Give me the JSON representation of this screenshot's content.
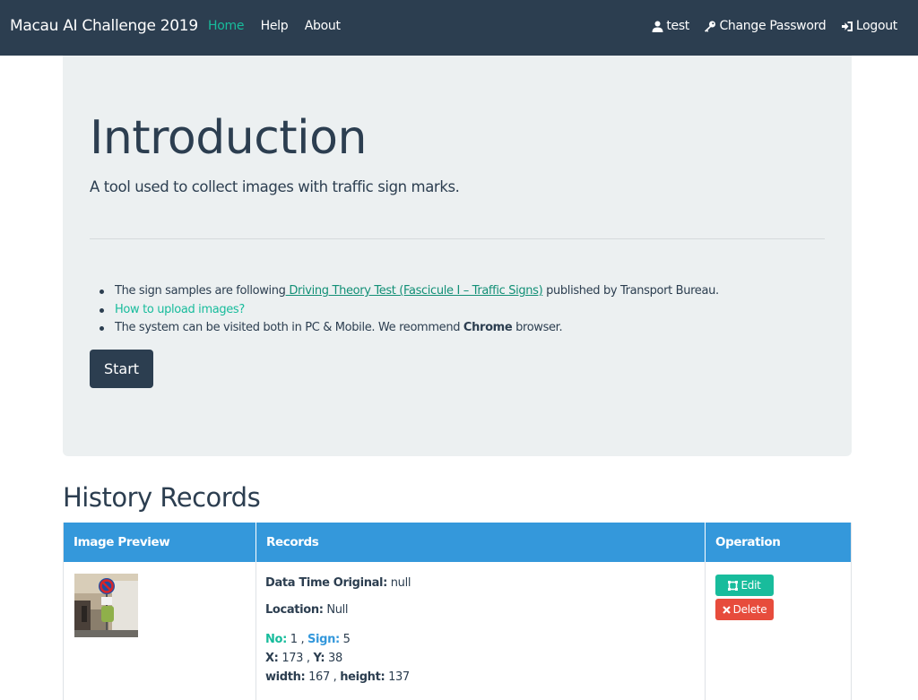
{
  "navbar": {
    "brand": "Macau AI Challenge 2019",
    "links": [
      "Home",
      "Help",
      "About"
    ],
    "active": "Home",
    "user": "test",
    "change_password": "Change Password",
    "logout": "Logout"
  },
  "intro": {
    "title": "Introduction",
    "lead": "A tool used to collect images with traffic sign marks.",
    "bullet1_pre": "The sign samples are following",
    "bullet1_link": " Driving Theory Test (Fascicule I – Traffic Signs)",
    "bullet1_post": " published by Transport Bureau.",
    "bullet2_link": "How to upload images?",
    "bullet3_pre": "The system can be visited both in PC & Mobile. We reommend ",
    "bullet3_bold": "Chrome",
    "bullet3_post": " browser.",
    "start_label": "Start"
  },
  "history": {
    "title": "History Records",
    "columns": [
      "Image Preview",
      "Records",
      "Operation"
    ],
    "rows": [
      {
        "date_label": "Data Time Original:",
        "date_value": " null",
        "location_label": "Location:",
        "location_value": " Null",
        "no_label": "No:",
        "no_value": " 1 , ",
        "sign_label": "Sign:",
        "sign_value": " 5",
        "x_label": "X:",
        "x_value": " 173 , ",
        "y_label": "Y:",
        "y_value": " 38",
        "width_label": "width:",
        "width_value": " 167 , ",
        "height_label": "height:",
        "height_value": " 137",
        "edit_label": "Edit",
        "delete_label": "Delete"
      }
    ]
  },
  "colors": {
    "navbar": "#2c3e50",
    "accent_teal": "#18bc9c",
    "table_header": "#3498db",
    "danger": "#e74c3c",
    "jumbotron": "#ecf0f1"
  },
  "icons": [
    "user-icon",
    "key-icon",
    "logout-icon",
    "edit-icon",
    "delete-icon"
  ]
}
